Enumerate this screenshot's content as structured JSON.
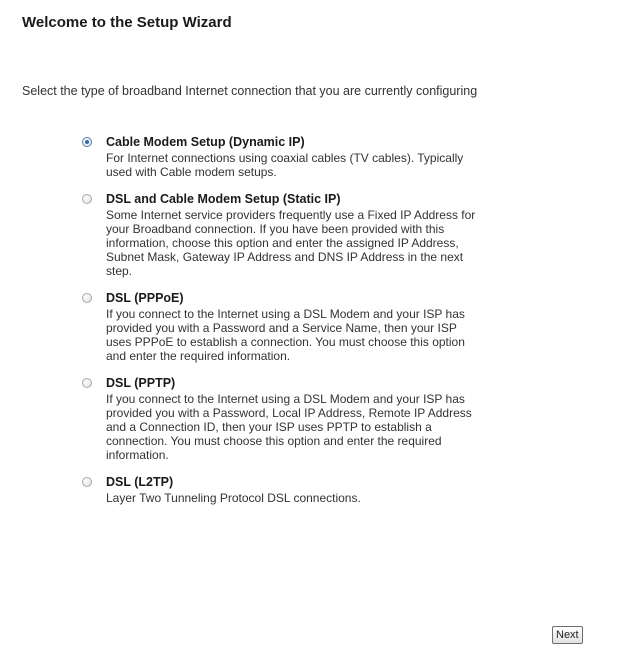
{
  "page": {
    "title": "Welcome to the Setup Wizard",
    "intro": "Select the type of broadband Internet connection that you are currently configuring"
  },
  "options": [
    {
      "title": "Cable Modem Setup (Dynamic IP)",
      "desc_lines": [
        "For Internet connections using coaxial cables (TV cables). Typically",
        "used with Cable modem setups."
      ],
      "selected": true
    },
    {
      "title": "DSL and Cable Modem Setup (Static IP)",
      "desc_lines": [
        "Some Internet service providers frequently use a Fixed IP Address for",
        "your Broadband connection. If you have been provided with this",
        "information, choose this option and enter the assigned IP Address,",
        "Subnet Mask, Gateway IP Address and DNS IP Address in the next",
        "step."
      ],
      "selected": false
    },
    {
      "title": "DSL (PPPoE)",
      "desc_lines": [
        "If you connect to the Internet using a DSL Modem and your ISP has",
        "provided you with a Password and a Service Name, then your ISP",
        "uses PPPoE to establish a connection. You must choose this option",
        "and enter the required information."
      ],
      "selected": false
    },
    {
      "title": "DSL (PPTP)",
      "desc_lines": [
        "If you connect to the Internet using a DSL Modem and your ISP has",
        "provided you with a Password, Local IP Address, Remote IP Address",
        "and a Connection ID, then your ISP uses PPTP to establish a",
        "connection. You must choose this option and enter the required",
        "information."
      ],
      "selected": false
    },
    {
      "title": "DSL (L2TP)",
      "desc_lines": [
        "Layer Two Tunneling Protocol DSL connections."
      ],
      "selected": false
    }
  ],
  "buttons": {
    "next_label": "Next"
  },
  "colors": {
    "radio_selected": "#2f6ea8",
    "text": "#333333"
  }
}
